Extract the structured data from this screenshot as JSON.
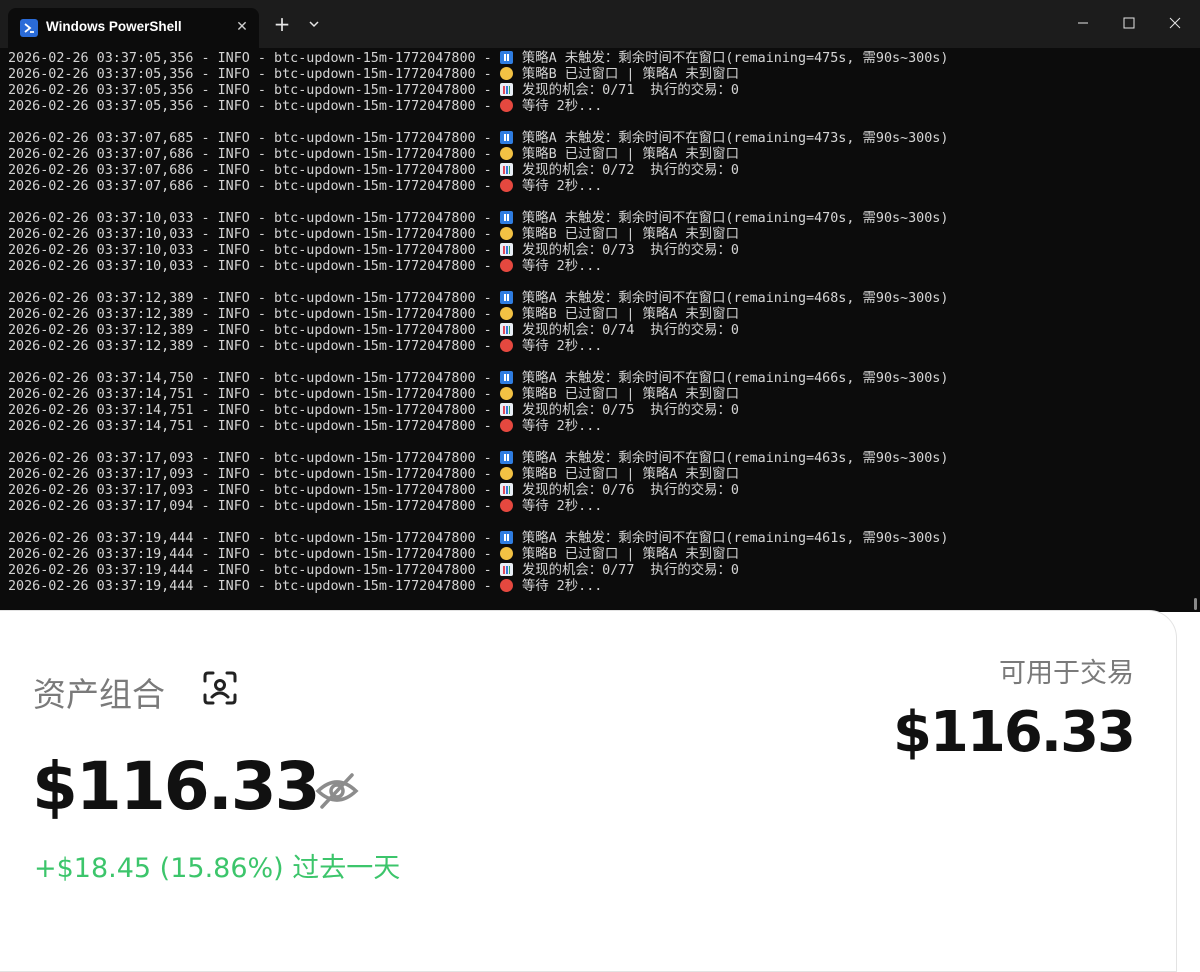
{
  "window": {
    "tab_title": "Windows PowerShell",
    "tab_close_glyph": "✕",
    "new_tab_glyph": "+",
    "icons": [
      "powershell-icon",
      "close-icon",
      "plus-icon",
      "chevron-down-icon",
      "minimize-icon",
      "maximize-icon",
      "window-close-icon"
    ]
  },
  "terminal": {
    "background": "#0c0c0c",
    "blocks": [
      {
        "ts": [
          "2026-02-26 03:37:05,356",
          "2026-02-26 03:37:05,356",
          "2026-02-26 03:37:05,356",
          "2026-02-26 03:37:05,356"
        ],
        "remaining": "475s",
        "opp": "0/71"
      },
      {
        "ts": [
          "2026-02-26 03:37:07,685",
          "2026-02-26 03:37:07,686",
          "2026-02-26 03:37:07,686",
          "2026-02-26 03:37:07,686"
        ],
        "remaining": "473s",
        "opp": "0/72"
      },
      {
        "ts": [
          "2026-02-26 03:37:10,033",
          "2026-02-26 03:37:10,033",
          "2026-02-26 03:37:10,033",
          "2026-02-26 03:37:10,033"
        ],
        "remaining": "470s",
        "opp": "0/73"
      },
      {
        "ts": [
          "2026-02-26 03:37:12,389",
          "2026-02-26 03:37:12,389",
          "2026-02-26 03:37:12,389",
          "2026-02-26 03:37:12,389"
        ],
        "remaining": "468s",
        "opp": "0/74"
      },
      {
        "ts": [
          "2026-02-26 03:37:14,750",
          "2026-02-26 03:37:14,751",
          "2026-02-26 03:37:14,751",
          "2026-02-26 03:37:14,751"
        ],
        "remaining": "466s",
        "opp": "0/75"
      },
      {
        "ts": [
          "2026-02-26 03:37:17,093",
          "2026-02-26 03:37:17,093",
          "2026-02-26 03:37:17,093",
          "2026-02-26 03:37:17,094"
        ],
        "remaining": "463s",
        "opp": "0/76"
      },
      {
        "ts": [
          "2026-02-26 03:37:19,444",
          "2026-02-26 03:37:19,444",
          "2026-02-26 03:37:19,444",
          "2026-02-26 03:37:19,444"
        ],
        "remaining": "461s",
        "opp": "0/77"
      }
    ],
    "line_prefix": " - INFO - btc-updown-15m-1772047800 - ",
    "msg_a_pre": "策略A 未触发：剩余时间不在窗口(remaining=",
    "msg_a_post": ", 需90s~300s)",
    "msg_b": "策略B 已过窗口 | 策略A 未到窗口",
    "msg_c_pre": "发现的机会：",
    "msg_c_post": "  执行的交易：0",
    "msg_d": "等待 2秒..."
  },
  "portfolio": {
    "title": "资产组合",
    "balance": "$116.33",
    "change": "+$18.45 (15.86%) 过去一天",
    "available_label": "可用于交易",
    "available_value": "$116.33",
    "change_color": "#3cc56b"
  }
}
